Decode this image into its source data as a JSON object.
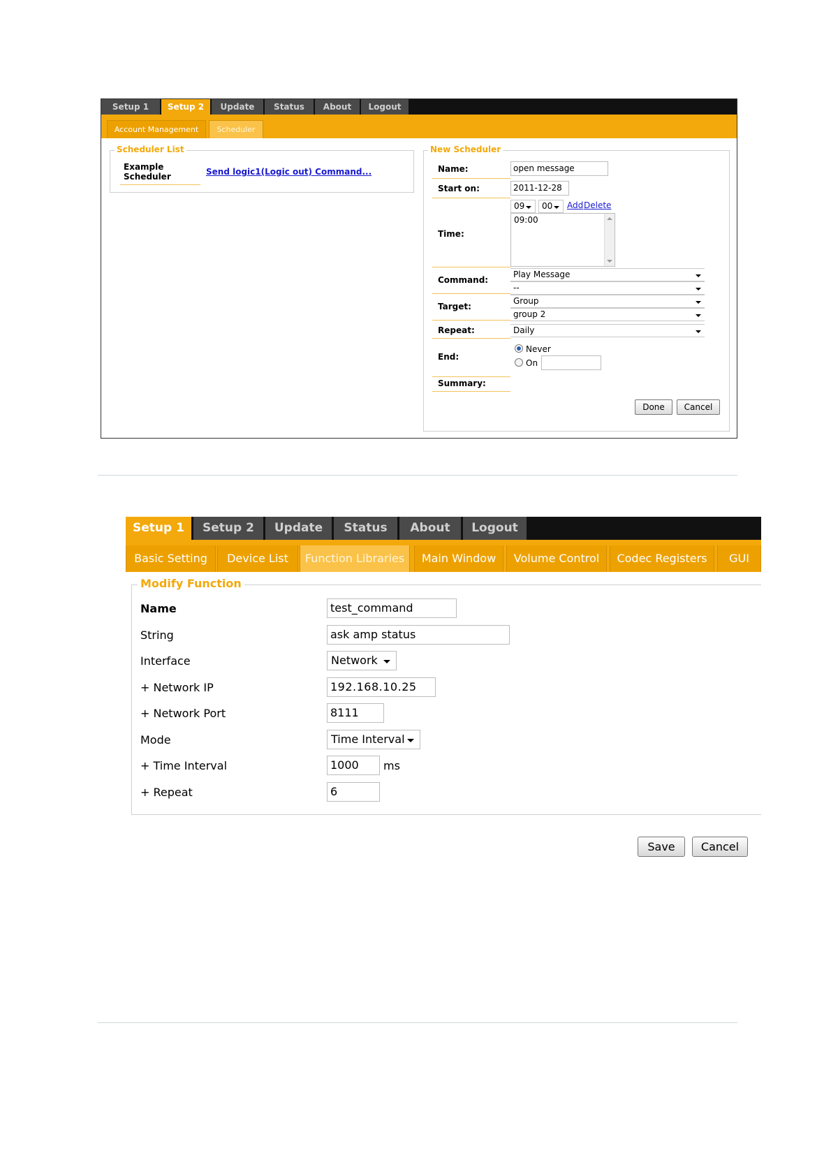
{
  "scheduler_screen": {
    "top_tabs": [
      "Setup 1",
      "Setup 2",
      "Update",
      "Status",
      "About",
      "Logout"
    ],
    "active_top_tab": "Setup 2",
    "sub_tabs": [
      "Account Management",
      "Scheduler"
    ],
    "active_sub_tab": "Scheduler",
    "scheduler_list": {
      "legend": "Scheduler List",
      "item_name": "Example Scheduler",
      "item_link": "Send logic1(Logic out) Command..."
    },
    "new_scheduler": {
      "legend": "New Scheduler",
      "name_label": "Name:",
      "name_value": "open message",
      "start_label": "Start on:",
      "start_value": "2011-12-28",
      "time_label": "Time:",
      "hour_value": "09",
      "minute_value": "00",
      "add_link": "Add",
      "delete_link": "Delete",
      "time_list": [
        "09:00"
      ],
      "command_label": "Command:",
      "command_value": "Play Message",
      "command_sub_value": "--",
      "target_label": "Target:",
      "target_value": "Group",
      "target_sub_value": "group 2",
      "repeat_label": "Repeat:",
      "repeat_value": "Daily",
      "end_label": "End:",
      "end_never": "Never",
      "end_on": "On",
      "summary_label": "Summary:",
      "done_button": "Done",
      "cancel_button": "Cancel"
    }
  },
  "function_screen": {
    "top_tabs": [
      "Setup 1",
      "Setup 2",
      "Update",
      "Status",
      "About",
      "Logout"
    ],
    "active_top_tab": "Setup 1",
    "sub_tabs": [
      "Basic Setting",
      "Device List",
      "Function Libraries",
      "Main Window",
      "Volume Control",
      "Codec Registers",
      "GUI"
    ],
    "active_sub_tab": "Function Libraries",
    "legend": "Modify Function",
    "fields": {
      "name_label": "Name",
      "name_value": "test_command",
      "string_label": "String",
      "string_value": "ask amp status",
      "interface_label": "Interface",
      "interface_value": "Network",
      "network_ip_label": "+ Network IP",
      "network_ip_value": "192.168.10.25",
      "network_port_label": "+ Network Port",
      "network_port_value": "8111",
      "mode_label": "Mode",
      "mode_value": "Time Interval",
      "time_interval_label": "+ Time Interval",
      "time_interval_value": "1000",
      "time_interval_unit": "ms",
      "repeat_label": "+ Repeat",
      "repeat_value": "6"
    },
    "save_button": "Save",
    "cancel_button": "Cancel"
  },
  "colors": {
    "accent": "#f3a90b",
    "tab_dark": "#4a4a4a",
    "bar_black": "#111111",
    "link": "#1a1ad0"
  }
}
